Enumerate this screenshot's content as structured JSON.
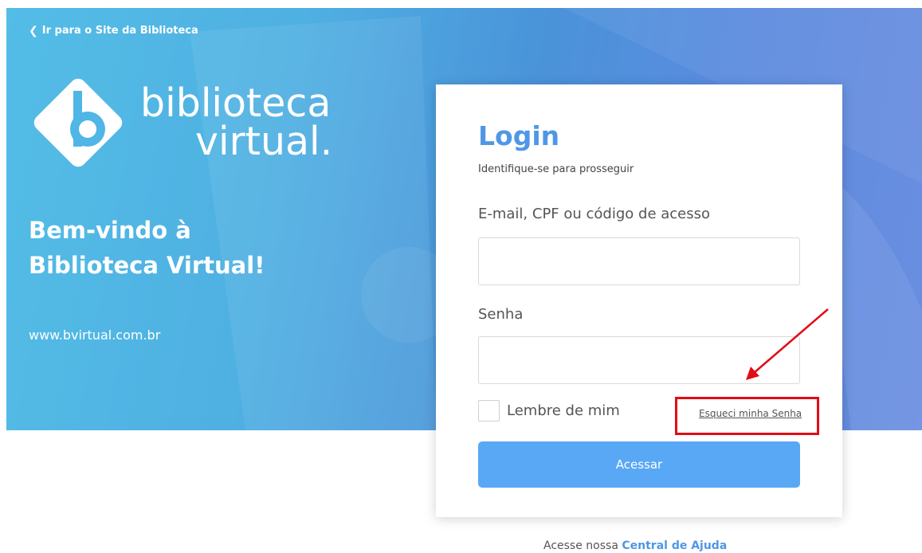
{
  "hero": {
    "back_link": "Ir para o Site da Biblioteca",
    "logo_line1": "biblioteca",
    "logo_line2": "virtual.",
    "welcome_line1": "Bem-vindo à",
    "welcome_line2": "Biblioteca Virtual!",
    "site_url": "www.bvirtual.com.br"
  },
  "login": {
    "title": "Login",
    "subtitle": "Identifique-se para prosseguir",
    "user_label": "E-mail, CPF ou código de acesso",
    "user_value": "",
    "password_label": "Senha",
    "password_value": "",
    "remember_label": "Lembre de mim",
    "forgot_label": "Esqueci minha Senha",
    "submit_label": "Acessar"
  },
  "footer": {
    "help_prefix": "Acesse nossa",
    "help_link": "Central de Ajuda"
  },
  "colors": {
    "accent": "#4f97e6",
    "button": "#59a8f5",
    "annotation": "#e10c16"
  },
  "icons": {
    "back": "chevron-left-icon",
    "logo": "bv-logo-icon",
    "annotation_arrow": "annotation-arrow"
  }
}
